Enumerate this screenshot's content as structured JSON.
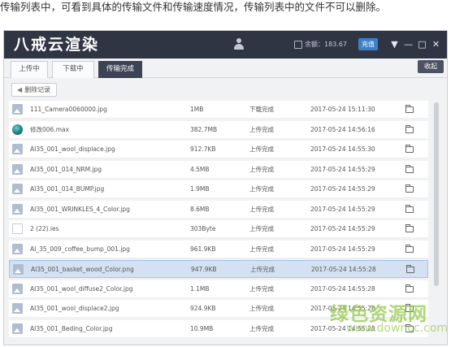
{
  "caption": "传输列表中，可看到具体的传输文件和传输速度情况，传输列表中的文件不可以删除。",
  "window": {
    "logo": "八戒云渲染",
    "balance_label": "余额：",
    "balance_value": "183.67",
    "recharge_label": "充值",
    "controls": [
      "▼",
      "—",
      "□",
      "✕"
    ]
  },
  "tabs": [
    {
      "label": "上传中",
      "active": false
    },
    {
      "label": "下载中",
      "active": false
    },
    {
      "label": "传输完成",
      "active": true
    }
  ],
  "collapse_label": "收起",
  "toolbar": {
    "delete_label": "删除记录"
  },
  "files": [
    {
      "name": "111_Camera0060000.jpg",
      "size": "1MB",
      "status": "下载完成",
      "time": "2017-05-24 15:11:30",
      "icon": "image-icon"
    },
    {
      "name": "修改006.max",
      "size": "382.7MB",
      "status": "上传完成",
      "time": "2017-05-24 14:56:16",
      "icon": "max-file-icon"
    },
    {
      "name": "AI35_001_wool_displace.jpg",
      "size": "912.7KB",
      "status": "上传完成",
      "time": "2017-05-24 14:55:30",
      "icon": "image-icon"
    },
    {
      "name": "AI35_001_014_NRM.jpg",
      "size": "4.5MB",
      "status": "上传完成",
      "time": "2017-05-24 14:55:29",
      "icon": "image-icon"
    },
    {
      "name": "AI35_001_014_BUMP.jpg",
      "size": "1.9MB",
      "status": "上传完成",
      "time": "2017-05-24 14:55:29",
      "icon": "image-icon"
    },
    {
      "name": "AI35_001_WRINKLES_4_Color.jpg",
      "size": "8.6MB",
      "status": "上传完成",
      "time": "2017-05-24 14:55:29",
      "icon": "image-icon"
    },
    {
      "name": "2 (22).ies",
      "size": "303Byte",
      "status": "上传完成",
      "time": "2017-05-24 14:55:29",
      "icon": "document-icon"
    },
    {
      "name": "AI_35_009_coffee_bump_001.jpg",
      "size": "961.9KB",
      "status": "上传完成",
      "time": "2017-05-24 14:55:29",
      "icon": "image-icon"
    },
    {
      "name": "AI35_001_basket_wood_Color.png",
      "size": "947.9KB",
      "status": "上传完成",
      "time": "2017-05-24 14:55:28",
      "icon": "image-icon",
      "selected": true
    },
    {
      "name": "AI35_001_wool_diffuse2_Color.jpg",
      "size": "1.1MB",
      "status": "上传完成",
      "time": "2017-05-24 14:55:28",
      "icon": "image-icon"
    },
    {
      "name": "AI35_001_wool_displace2.jpg",
      "size": "924.9KB",
      "status": "上传完成",
      "time": "2017-05-24 14:55:28",
      "icon": "image-icon"
    },
    {
      "name": "AI35_001_Beding_Color.jpg",
      "size": "10.9MB",
      "status": "上传完成",
      "time": "2017-05-24 14:55:28",
      "icon": "image-icon"
    }
  ],
  "watermark": {
    "text": "绿色资源网",
    "url": "www.downcc.com"
  }
}
